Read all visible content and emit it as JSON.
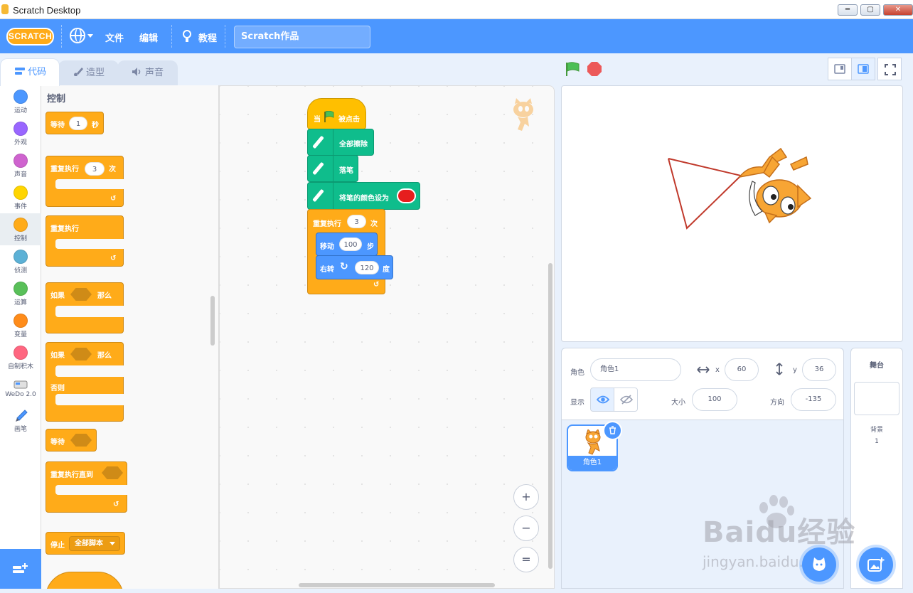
{
  "window": {
    "title": "Scratch Desktop",
    "minimize": "━",
    "maximize": "▢",
    "close": "✕"
  },
  "menubar": {
    "logo": "SCRATCH",
    "file": "文件",
    "edit": "编辑",
    "tutorials": "教程",
    "project_title": "Scratch作品"
  },
  "tabs": [
    {
      "label": "代码"
    },
    {
      "label": "造型"
    },
    {
      "label": "声音"
    }
  ],
  "categories": [
    {
      "label": "运动",
      "color": "#4c97ff"
    },
    {
      "label": "外观",
      "color": "#9966ff"
    },
    {
      "label": "声音",
      "color": "#cf63cf"
    },
    {
      "label": "事件",
      "color": "#ffd500"
    },
    {
      "label": "控制",
      "color": "#ffab19"
    },
    {
      "label": "侦测",
      "color": "#5cb1d6"
    },
    {
      "label": "运算",
      "color": "#59c059"
    },
    {
      "label": "变量",
      "color": "#ff8c1a"
    },
    {
      "label": "自制积木",
      "color": "#ff6680"
    },
    {
      "label": "WeDo 2.0"
    },
    {
      "label": "画笔"
    }
  ],
  "palette": {
    "heading": "控制",
    "wait": {
      "label": "等待",
      "value": "1",
      "unit": "秒"
    },
    "repeat": {
      "label": "重复执行",
      "value": "3",
      "unit": "次"
    },
    "forever": {
      "label": "重复执行"
    },
    "if_then": {
      "if": "如果",
      "then": "那么"
    },
    "if_else": {
      "if": "如果",
      "then": "那么",
      "else": "否则"
    },
    "wait_until": {
      "label": "等待"
    },
    "repeat_until": {
      "label": "重复执行直到"
    },
    "stop": {
      "label": "停止",
      "option": "全部脚本"
    }
  },
  "script": {
    "when_flag": {
      "when": "当",
      "clicked": "被点击"
    },
    "erase_all": "全部擦除",
    "pen_down": "落笔",
    "set_color": {
      "label": "将笔的颜色设为",
      "color": "#e61e1e"
    },
    "repeat": {
      "label": "重复执行",
      "value": "3",
      "unit": "次"
    },
    "move": {
      "label": "移动",
      "value": "100",
      "unit": "步"
    },
    "turn": {
      "label": "右转",
      "value": "120",
      "unit": "度"
    }
  },
  "zoom": {
    "in": "+",
    "out": "−",
    "reset": "="
  },
  "sprite_info": {
    "sprite_label": "角色",
    "sprite_name": "角色1",
    "x_label": "x",
    "x": "60",
    "y_label": "y",
    "y": "36",
    "show_label": "显示",
    "size_label": "大小",
    "size": "100",
    "direction_label": "方向",
    "direction": "-135"
  },
  "sprites": [
    {
      "name": "角色1"
    }
  ],
  "stage_pane": {
    "title": "舞台",
    "backdrops_label": "背景",
    "backdrops_count": "1"
  },
  "watermark": {
    "brand": "Baidu经验",
    "url": "jingyan.baidu.com"
  },
  "colors": {
    "accent": "#4c97ff",
    "control": "#ffab19",
    "pen": "#0fbd8c",
    "event": "#ffbf00",
    "line": "#c0392b"
  }
}
